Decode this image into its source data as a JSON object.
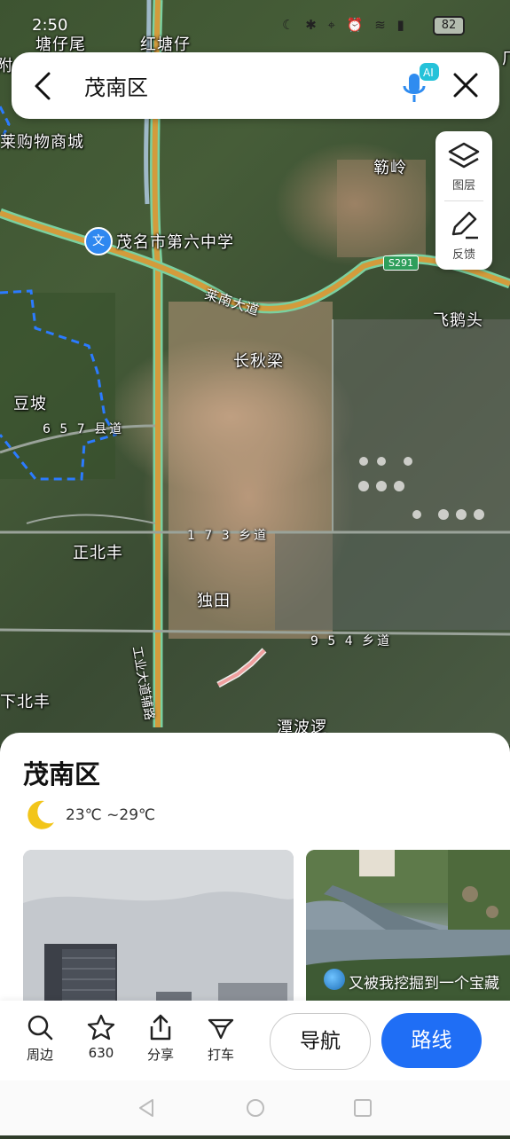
{
  "status_bar": {
    "time": "2:50",
    "battery": "82"
  },
  "search": {
    "query": "茂南区"
  },
  "side_tools": [
    {
      "label": "图层",
      "icon": "layers-icon"
    },
    {
      "label": "反馈",
      "icon": "edit-feedback-icon"
    }
  ],
  "map_labels": {
    "tangzaiwei": "塘仔尾",
    "hongtangzai": "红塘仔",
    "shopping_mall": "莱购物商城",
    "jinling": "簕岭",
    "school": "茂名市第六中学",
    "route_s291": "S291",
    "lainan_road": "莱南大道",
    "feietou": "飞鹅头",
    "changqiuliang": "长秋梁",
    "doupo": "豆坡",
    "county_road_657": "6 5 7 县道",
    "zhengbeifeng": "正北丰",
    "township_road_173": "1 7 3 乡道",
    "dutian": "独田",
    "township_road_954": "9 5 4 乡道",
    "industrial_road": "工业大道辅路",
    "xiabeifeng": "下北丰",
    "tanbobu": "潭波逻",
    "left_edge": "附",
    "right_edge": "厂"
  },
  "place": {
    "title": "茂南区",
    "temperature": "23℃ ~29℃",
    "photo_caption": "又被我挖掘到一个宝藏"
  },
  "actions": [
    {
      "label": "周边",
      "icon": "search-nearby-icon"
    },
    {
      "label": "630",
      "icon": "star-icon"
    },
    {
      "label": "分享",
      "icon": "share-icon"
    },
    {
      "label": "打车",
      "icon": "taxi-icon"
    }
  ],
  "buttons": {
    "navigate": "导航",
    "route": "路线"
  }
}
